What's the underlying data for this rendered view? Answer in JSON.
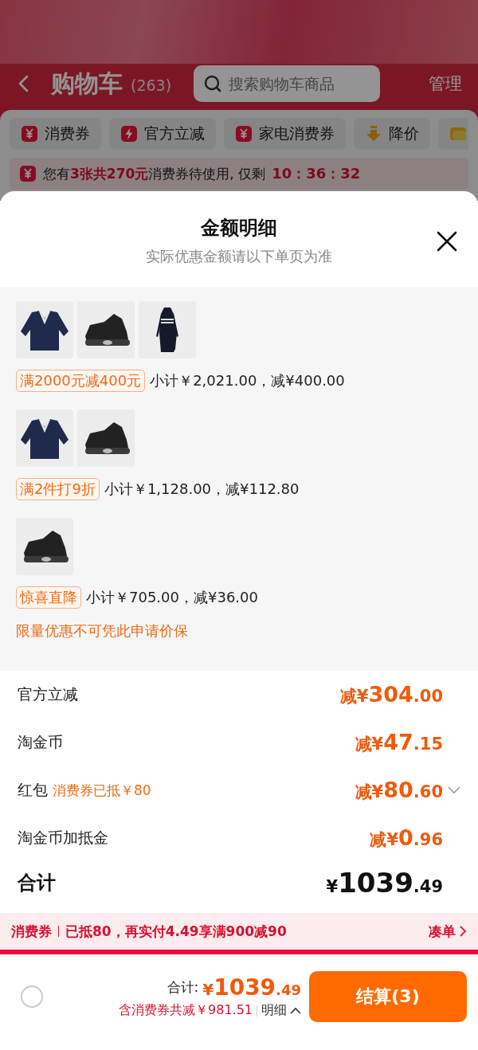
{
  "header": {
    "title": "购物车",
    "count": "(263)",
    "search": {
      "placeholder": "搜索购物车商品"
    },
    "manage": "管理"
  },
  "filter_chips": [
    {
      "kind": "coupon",
      "label": "消费券"
    },
    {
      "kind": "bolt",
      "label": "官方立减"
    },
    {
      "kind": "coupon",
      "label": "家电消费券"
    },
    {
      "kind": "arrow",
      "label": "降价"
    },
    {
      "kind": "wallet"
    }
  ],
  "notice": {
    "text": "您有**3张共270元**消费券待使用, 仅剩",
    "countdown": "10：36：32"
  },
  "sheet": {
    "title": "金额明细",
    "subtitle": "实际优惠金额请以下单页为准",
    "promo_groups": [
      {
        "tag": "满2000元减400元",
        "summary": "小计￥2,021.00，减¥400.00"
      },
      {
        "tag": "满2件打9折",
        "summary": "小计￥1,128.00，减¥112.80"
      },
      {
        "tag": "惊喜直降",
        "summary": "小计￥705.00，减¥36.00"
      }
    ],
    "note": "限量优惠不可凭此申请价保",
    "discounts": [
      {
        "label": "官方立减",
        "amount": "减¥304.00",
        "expandable": false
      },
      {
        "label": "淘金币",
        "amount": "减¥47.15",
        "expandable": false
      },
      {
        "label": "红包",
        "detail": "消费券已抵￥80",
        "amount": "减¥80.60",
        "expandable": true
      },
      {
        "label": "淘金币加抵金",
        "amount": "减¥0.96",
        "expandable": false
      }
    ],
    "total": {
      "label": "合计",
      "amount": "¥1039.49"
    }
  },
  "coupon_bar": {
    "label": "消费券",
    "text": "已抵80，再实付4.49享满900减90",
    "link": "凑单"
  },
  "checkout": {
    "select_all": {
      "checked": false
    },
    "total_label": "合计:",
    "total": "¥1039.49",
    "saving": "含消费券共减￥981.51",
    "detail_link": "明细",
    "button": "结算(3)"
  }
}
